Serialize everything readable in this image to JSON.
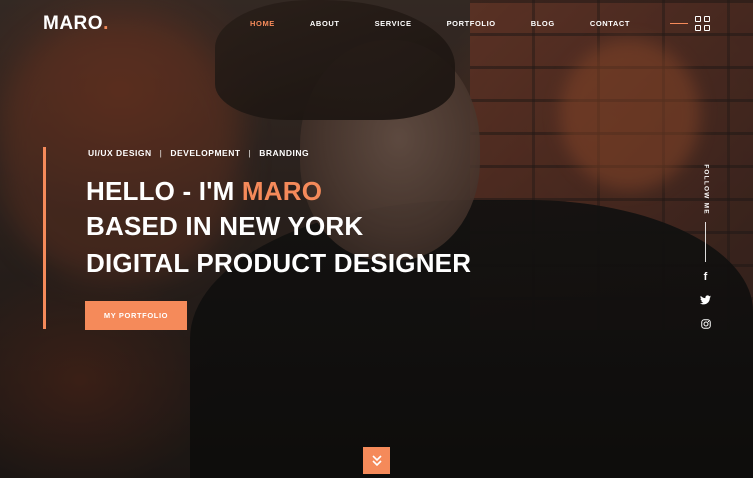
{
  "brand": {
    "name": "MARO",
    "dot": ".",
    "accent": "#f58a5a"
  },
  "nav": {
    "items": [
      {
        "label": "HOME",
        "active": true
      },
      {
        "label": "ABOUT",
        "active": false
      },
      {
        "label": "SERVICE",
        "active": false
      },
      {
        "label": "PORTFOLIO",
        "active": false
      },
      {
        "label": "BLOG",
        "active": false
      },
      {
        "label": "CONTACT",
        "active": false
      }
    ],
    "menu_icon": "grid-icon"
  },
  "hero": {
    "tags": [
      "UI/UX DESIGN",
      "DEVELOPMENT",
      "BRANDING"
    ],
    "separator": "|",
    "line1_prefix": "HELLO - I'M ",
    "line1_name": "MARO",
    "line2": "BASED IN NEW YORK",
    "line3": "DIGITAL PRODUCT DESIGNER",
    "cta_label": "MY PORTFOLIO"
  },
  "social": {
    "label": "FOLLOW ME",
    "icons": [
      "facebook-icon",
      "twitter-icon",
      "instagram-icon"
    ]
  },
  "scroll": {
    "icon": "chevrons-down-icon"
  }
}
